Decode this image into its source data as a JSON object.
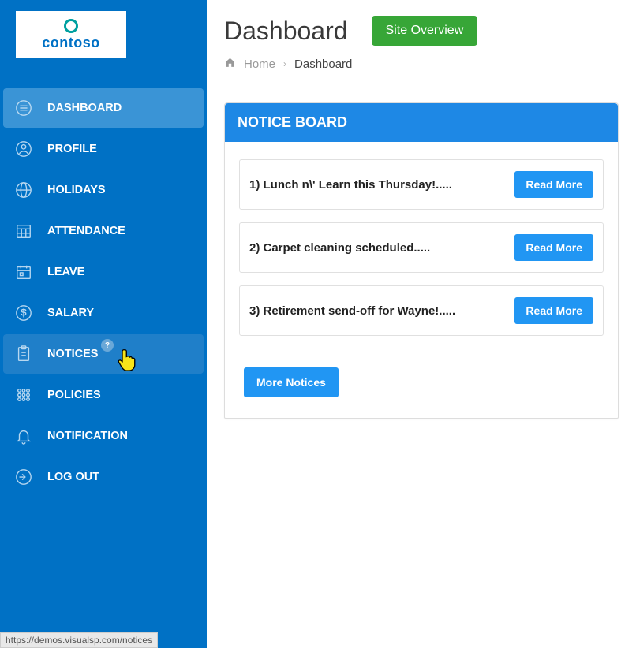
{
  "brand": {
    "name": "contoso"
  },
  "sidebar": {
    "items": [
      {
        "label": "DASHBOARD",
        "icon": "list-icon"
      },
      {
        "label": "PROFILE",
        "icon": "user-icon"
      },
      {
        "label": "HOLIDAYS",
        "icon": "globe-icon"
      },
      {
        "label": "ATTENDANCE",
        "icon": "calendar-grid-icon"
      },
      {
        "label": "LEAVE",
        "icon": "calendar-icon"
      },
      {
        "label": "SALARY",
        "icon": "dollar-icon"
      },
      {
        "label": "NOTICES",
        "icon": "clipboard-icon",
        "badge": "?"
      },
      {
        "label": "POLICIES",
        "icon": "grid-icon"
      },
      {
        "label": "NOTIFICATION",
        "icon": "bell-icon"
      },
      {
        "label": "LOG OUT",
        "icon": "logout-icon"
      }
    ]
  },
  "header": {
    "title": "Dashboard",
    "action_label": "Site Overview"
  },
  "breadcrumb": {
    "home_label": "Home",
    "current_label": "Dashboard"
  },
  "notice_board": {
    "title": "NOTICE BOARD",
    "items": [
      {
        "text": "1) Lunch n\\' Learn this Thursday!.....",
        "button": "Read More"
      },
      {
        "text": "2) Carpet cleaning scheduled.....",
        "button": "Read More"
      },
      {
        "text": "3) Retirement send-off for Wayne!.....",
        "button": "Read More"
      }
    ],
    "more_label": "More Notices"
  },
  "status_url": "https://demos.visualsp.com/notices"
}
